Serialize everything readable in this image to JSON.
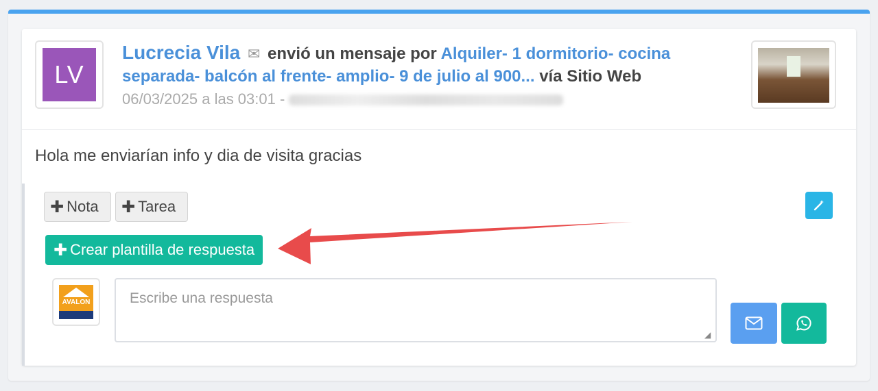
{
  "card": {
    "avatar_initials": "LV",
    "sender_name": "Lucrecia Vila",
    "action_text": "envió un mensaje por",
    "property_link": "Alquiler- 1 dormitorio- cocina separada- balcón al frente- amplio- 9 de julio al 900...",
    "via_text": "vía Sitio Web",
    "meta_date": "06/03/2025 a las 03:01 -",
    "message_body": "Hola me enviarían info y dia de visita gracias"
  },
  "actions": {
    "nota_label": "Nota",
    "tarea_label": "Tarea",
    "template_label": "Crear plantilla de respuesta"
  },
  "reply": {
    "placeholder": "Escribe una respuesta",
    "logo_text": "AVALON"
  },
  "icons": {
    "mail": "envelope-icon",
    "whatsapp": "whatsapp-icon",
    "wand": "magic-wand-icon",
    "sender_mail": "envelope-icon"
  },
  "colors": {
    "accent_blue": "#4a90d9",
    "avatar_purple": "#9a56b9",
    "green": "#13b99c",
    "mail_button": "#5a9ff0",
    "wand_button": "#2ab5e6",
    "arrow_red": "#e84b4b"
  }
}
